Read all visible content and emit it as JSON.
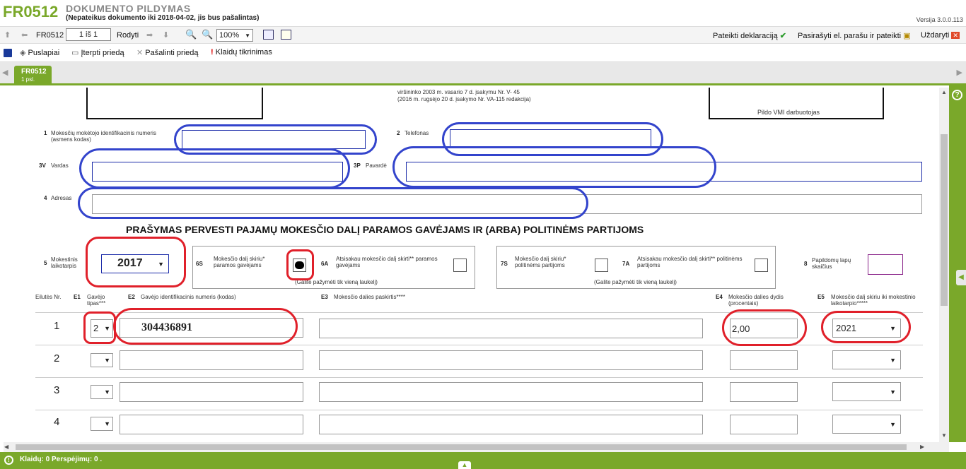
{
  "header": {
    "form_code": "FR0512",
    "title": "DOKUMENTO PILDYMAS",
    "subtitle": "(Nepateikus dokumento iki 2018-04-02, jis bus pašalintas)",
    "version": "Versija 3.0.0.113"
  },
  "toolbar1": {
    "form_name": "FR0512",
    "page_value": "1 iš 1",
    "show_label": "Rodyti",
    "zoom_value": "100%",
    "submit_label": "Pateikti deklaraciją",
    "sign_label": "Pasirašyti el. parašu ir pateikti",
    "close_label": "Uždaryti"
  },
  "toolbar2": {
    "pages_label": "Puslapiai",
    "insert_label": "Įterpti priedą",
    "remove_label": "Pašalinti priedą",
    "errors_label": "Klaidų tikrinimas"
  },
  "tab": {
    "name": "FR0512",
    "page": "1 psl."
  },
  "form": {
    "top_text_1": "viršininko 2003 m. vasario 7 d. įsakymu Nr. V- 45",
    "top_text_2": "(2016 m. rugsėjo 20 d. įsakymo Nr. VA-115 redakcija)",
    "vmi_label": "Pildo VMI darbuotojas",
    "f1_num": "1",
    "f1_label": "Mokesčių mokėtojo identifikacinis numeris (asmens kodas)",
    "f2_num": "2",
    "f2_label": "Telefonas",
    "f3v_num": "3V",
    "f3v_label": "Vardas",
    "f3p_num": "3P",
    "f3p_label": "Pavardė",
    "f4_num": "4",
    "f4_label": "Adresas",
    "main_title": "PRAŠYMAS PERVESTI PAJAMŲ MOKESČIO DALĮ PARAMOS GAVĖJAMS IR (ARBA) POLITINĖMS PARTIJOMS",
    "f5_num": "5",
    "f5_label": "Mokestinis laikotarpis",
    "f5_value": "2017",
    "f6s_num": "6S",
    "f6s_label": "Mokesčio dalį skiriu* paramos gavėjams",
    "f6a_num": "6A",
    "f6a_label": "Atsisakau mokesčio dalį skirti** paramos gavėjams",
    "g6_note": "(Galite pažymėti tik vieną laukelį)",
    "f7s_num": "7S",
    "f7s_label": "Mokesčio dalį skiriu* politinėms partijoms",
    "f7a_num": "7A",
    "f7a_label": "Atsisakau mokesčio dalį skirti** politinėms partijoms",
    "g7_note": "(Galite pažymėti tik vieną laukelį)",
    "f8_num": "8",
    "f8_label": "Papildomų lapų skaičius"
  },
  "table": {
    "h_row": "Eilutės Nr.",
    "h_e1_code": "E1",
    "h_e1": "Gavėjo tipas***",
    "h_e2_code": "E2",
    "h_e2": "Gavėjo identifikacinis numeris (kodas)",
    "h_e3_code": "E3",
    "h_e3": "Mokesčio dalies paskirtis****",
    "h_e4_code": "E4",
    "h_e4": "Mokesčio dalies dydis (procentais)",
    "h_e5_code": "E5",
    "h_e5": "Mokesčio dalį skiriu iki mokestinio laikotarpio*****",
    "rows": [
      {
        "nr": "1",
        "type": "2",
        "id": "304436891",
        "purpose": "",
        "percent": "2,00",
        "year": "2021"
      },
      {
        "nr": "2",
        "type": "",
        "id": "",
        "purpose": "",
        "percent": "",
        "year": ""
      },
      {
        "nr": "3",
        "type": "",
        "id": "",
        "purpose": "",
        "percent": "",
        "year": ""
      },
      {
        "nr": "4",
        "type": "",
        "id": "",
        "purpose": "",
        "percent": "",
        "year": ""
      }
    ]
  },
  "status": {
    "text": "Klaidų: 0 Perspėjimų: 0 ."
  }
}
